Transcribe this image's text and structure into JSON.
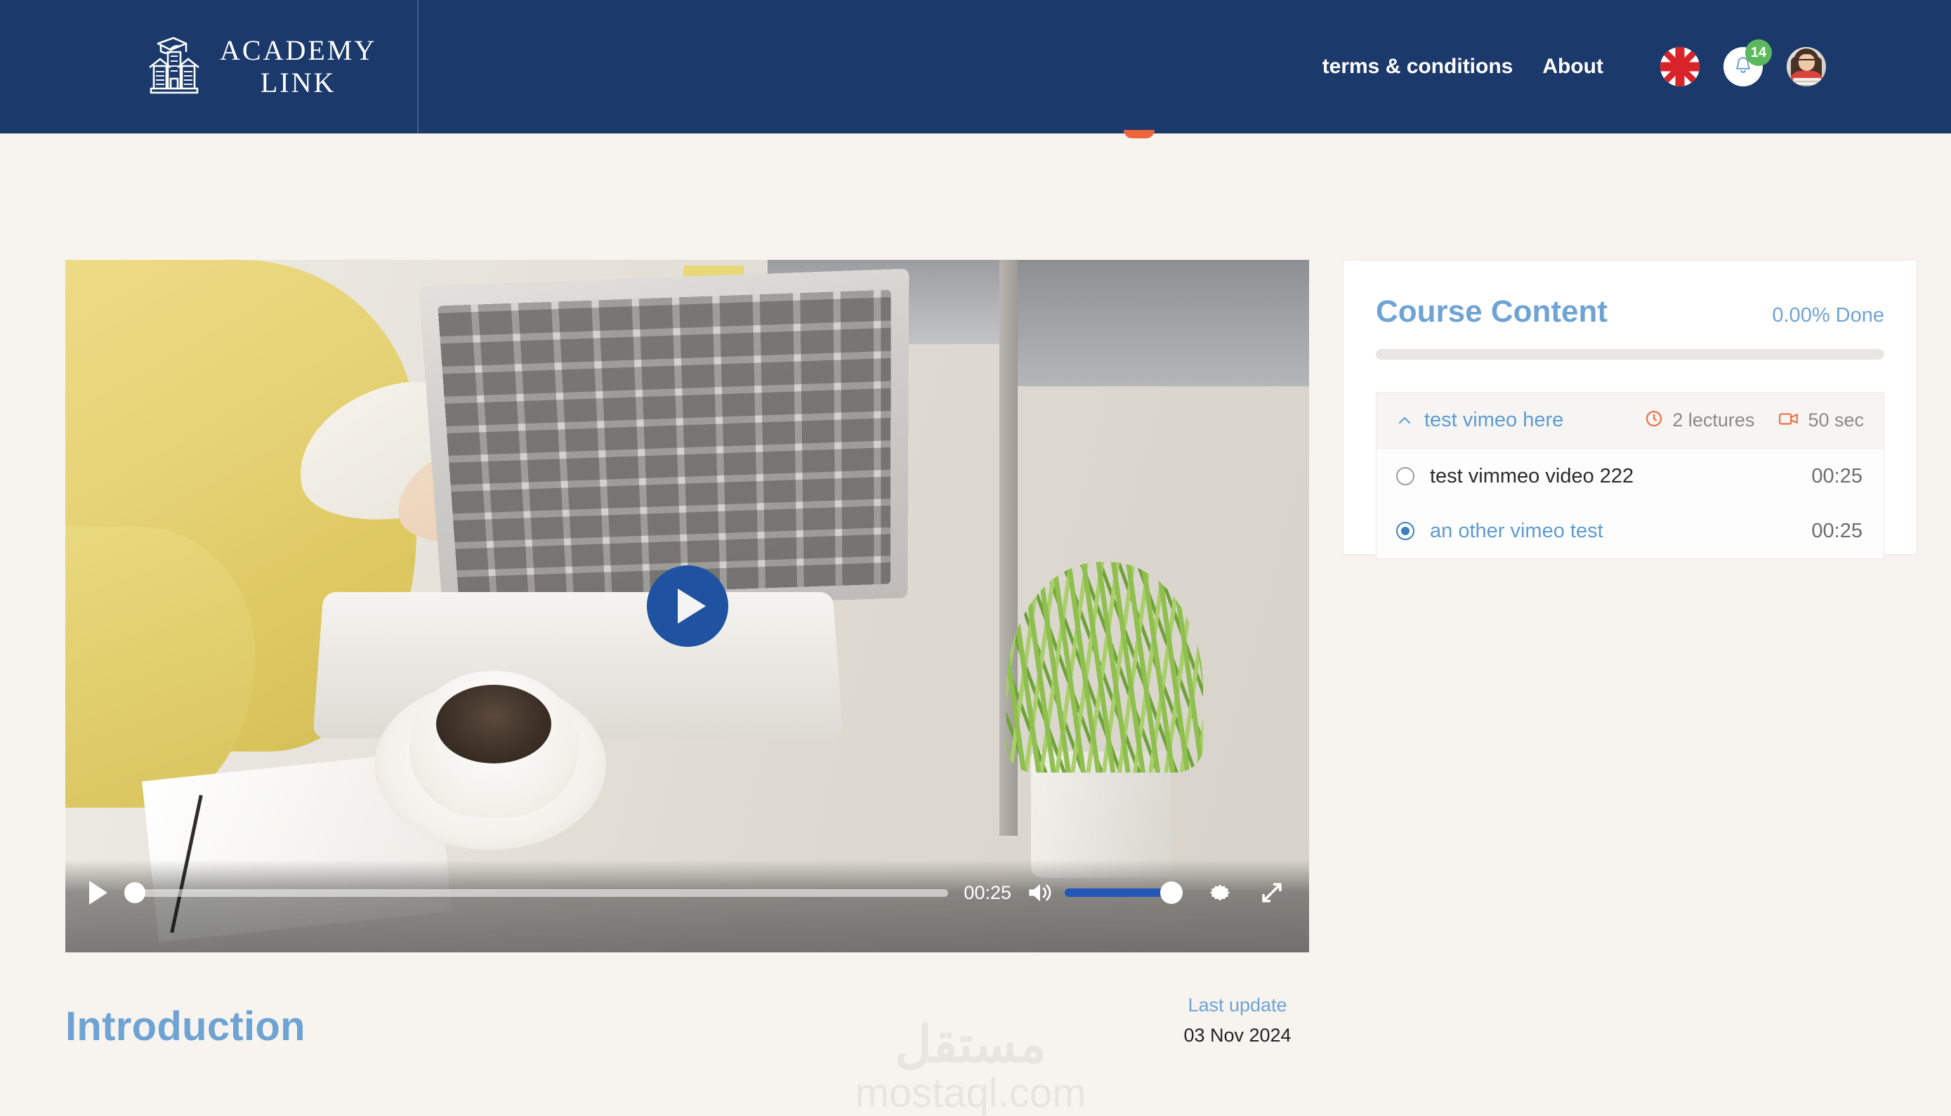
{
  "header": {
    "brand": {
      "line1": "ACADEMY",
      "line2": "LINK",
      "icon": "graduation-building-icon"
    },
    "nav": [
      {
        "label": "terms & conditions"
      },
      {
        "label": "About"
      }
    ],
    "icons": {
      "language_flag": "uk-flag-icon",
      "notifications": {
        "icon": "bell-icon",
        "count": "14",
        "badge_color": "#5cb85c"
      },
      "avatar": "user-avatar"
    },
    "bg_color": "#1b3a6b"
  },
  "player": {
    "overlay_play": "play-icon",
    "overlay_color": "#1f52a0",
    "controls": {
      "play_icon": "play-icon",
      "current_time": "00:25",
      "volume_icon": "volume-high-icon",
      "volume_level": 100,
      "settings_icon": "gear-icon",
      "fullscreen_icon": "fullscreen-icon",
      "progress_percent": 0
    }
  },
  "lesson": {
    "title": "Introduction",
    "last_update_label": "Last update",
    "last_update_date": "03 Nov 2024"
  },
  "watermark": {
    "arabic": "مستقل",
    "latin": "mostaql.com"
  },
  "course_content": {
    "title": "Course Content",
    "percent_done": "0.00% Done",
    "progress_percent": 0,
    "sections": [
      {
        "title": "test vimeo here",
        "expanded": true,
        "chevron": "chevron-up-icon",
        "lectures_count": "2 lectures",
        "lectures_icon": "clock-icon",
        "duration": "50 sec",
        "duration_icon": "video-camera-icon",
        "lectures": [
          {
            "title": "test vimmeo video 222",
            "duration": "00:25",
            "selected": false
          },
          {
            "title": "an other vimeo test",
            "duration": "00:25",
            "selected": true
          }
        ]
      }
    ]
  },
  "colors": {
    "navy": "#1b3a6b",
    "accent_blue": "#6fa3d4",
    "orange": "#f0663c",
    "page_bg": "#f7f4f0"
  }
}
